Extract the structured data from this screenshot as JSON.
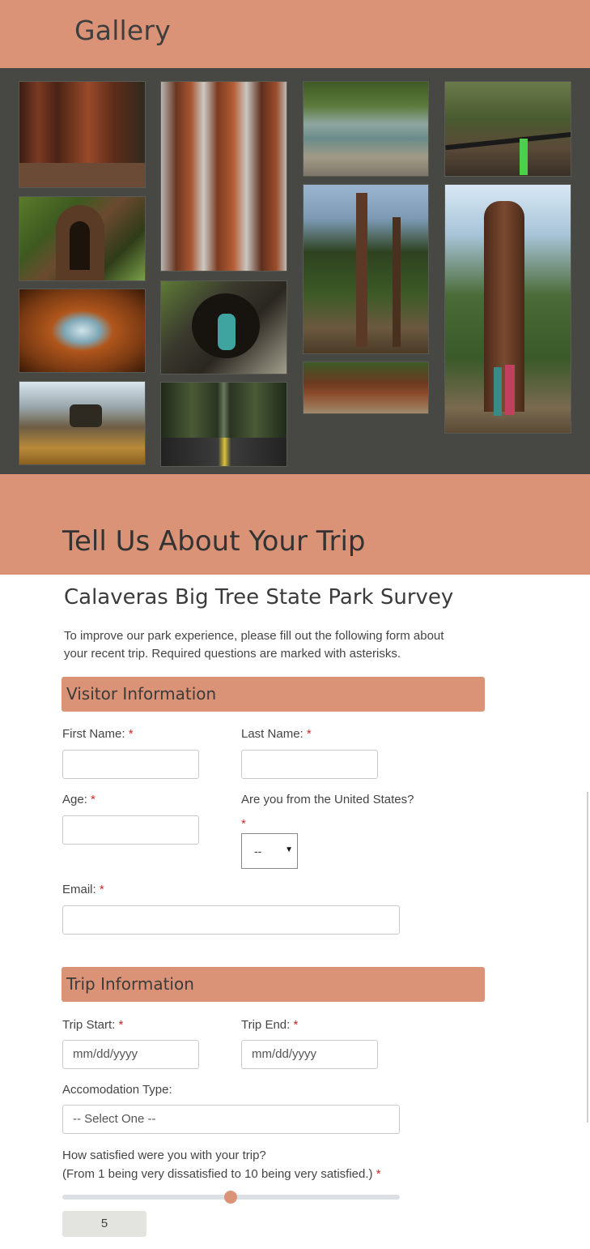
{
  "gallery": {
    "title": "Gallery",
    "photos": [
      {
        "alt": "giant sequoia trunks with hiker"
      },
      {
        "alt": "hollow sequoia tree with ferns"
      },
      {
        "alt": "view out of orange tent"
      },
      {
        "alt": "dog wading in mountain lake"
      },
      {
        "alt": "tall sequoias in fog"
      },
      {
        "alt": "woman sitting inside fallen log"
      },
      {
        "alt": "road through redwood forest"
      },
      {
        "alt": "river with rocks"
      },
      {
        "alt": "forest trail with hiker"
      },
      {
        "alt": "base of large sequoia"
      },
      {
        "alt": "mountain bike handlebars on trail"
      },
      {
        "alt": "couple posing under giant sequoia"
      }
    ]
  },
  "trip_section": {
    "title": "Tell Us About Your Trip"
  },
  "survey": {
    "title": "Calaveras Big Tree State Park Survey",
    "intro": "To improve our park experience, please fill out the following form about your recent trip. Required questions are marked with asterisks.",
    "required_mark": "*",
    "visitor": {
      "heading": "Visitor Information",
      "first_name_label": "First Name:",
      "last_name_label": "Last Name:",
      "age_label": "Age:",
      "us_label": "Are you from the United States?",
      "us_value": "--",
      "email_label": "Email:"
    },
    "trip": {
      "heading": "Trip Information",
      "start_label": "Trip Start:",
      "start_placeholder": "mm/dd/yyyy",
      "end_label": "Trip End:",
      "end_placeholder": "mm/dd/yyyy",
      "accommodation_label": "Accomodation Type:",
      "accommodation_value": "-- Select One --",
      "satisfaction_label": "How satisfied were you with your trip?",
      "satisfaction_hint": "(From 1 being very dissatisfied to 10 being very satisfied.)",
      "satisfaction_value": "5",
      "satisfaction_min": 1,
      "satisfaction_max": 10
    }
  },
  "colors": {
    "accent": "#db9377",
    "gallery_bg": "#474743",
    "required": "#cc2a2a"
  }
}
